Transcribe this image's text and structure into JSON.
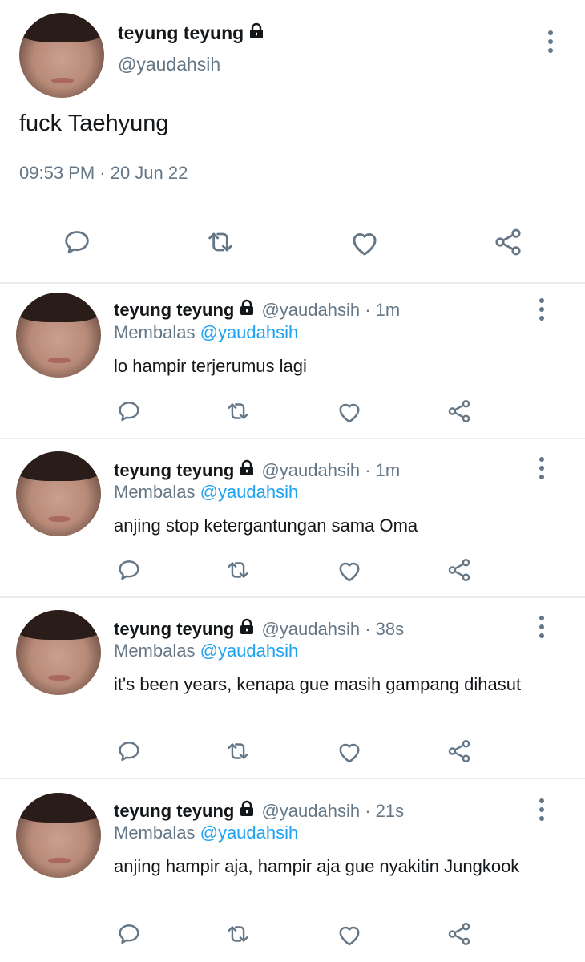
{
  "main_tweet": {
    "name": "teyung teyung",
    "handle": "@yaudahsih",
    "text": "fuck Taehyung",
    "timestamp": "09:53 PM · 20 Jun 22"
  },
  "replies": [
    {
      "name": "teyung teyung",
      "handle": "@yaudahsih",
      "time": "· 1m",
      "replying_label": "Membalas",
      "replying_to": "@yaudahsih",
      "text": "lo hampir terjerumus lagi"
    },
    {
      "name": "teyung teyung",
      "handle": "@yaudahsih",
      "time": "· 1m",
      "replying_label": "Membalas",
      "replying_to": "@yaudahsih",
      "text": "anjing stop ketergantungan sama Oma"
    },
    {
      "name": "teyung teyung",
      "handle": "@yaudahsih",
      "time": "· 38s",
      "replying_label": "Membalas",
      "replying_to": "@yaudahsih",
      "text": "it's been years, kenapa gue masih gampang dihasut"
    },
    {
      "name": "teyung teyung",
      "handle": "@yaudahsih",
      "time": "· 21s",
      "replying_label": "Membalas",
      "replying_to": "@yaudahsih",
      "text": "anjing hampir aja, hampir aja gue nyakitin Jungkook"
    }
  ],
  "icons": [
    "lock-icon",
    "more-vertical-icon",
    "reply-icon",
    "retweet-icon",
    "like-icon",
    "share-icon"
  ],
  "colors": {
    "text": "#14171a",
    "secondary": "#657786",
    "link": "#1da1f2",
    "divider": "#e6ecf0"
  }
}
